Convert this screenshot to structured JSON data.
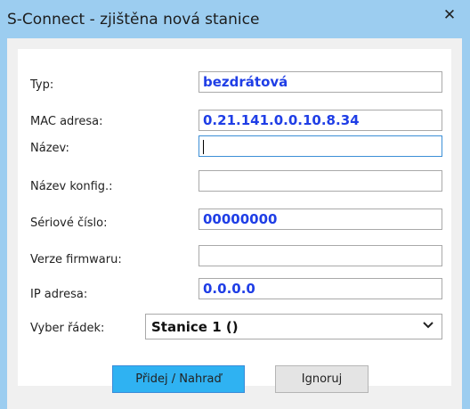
{
  "window": {
    "title": "S-Connect - zjištěna nová stanice",
    "close_label": "✕"
  },
  "form": {
    "typ": {
      "label": "Typ:",
      "value": "bezdrátová"
    },
    "mac": {
      "label": "MAC adresa:",
      "value": "0.21.141.0.0.10.8.34"
    },
    "nazev": {
      "label": "Název:",
      "value": ""
    },
    "nazev_konfig": {
      "label": "Název konfig.:",
      "value": ""
    },
    "seriove_cislo": {
      "label": "Sériové číslo:",
      "value": "00000000"
    },
    "verze_firmwaru": {
      "label": "Verze firmwaru:",
      "value": ""
    },
    "ip": {
      "label": "IP adresa:",
      "value": "0.0.0.0"
    },
    "vyber_radek": {
      "label": "Vyber řádek:",
      "selected": "Stanice 1 ()"
    }
  },
  "buttons": {
    "add_replace": "Přidej / Nahraď",
    "ignore": "Ignoruj"
  }
}
